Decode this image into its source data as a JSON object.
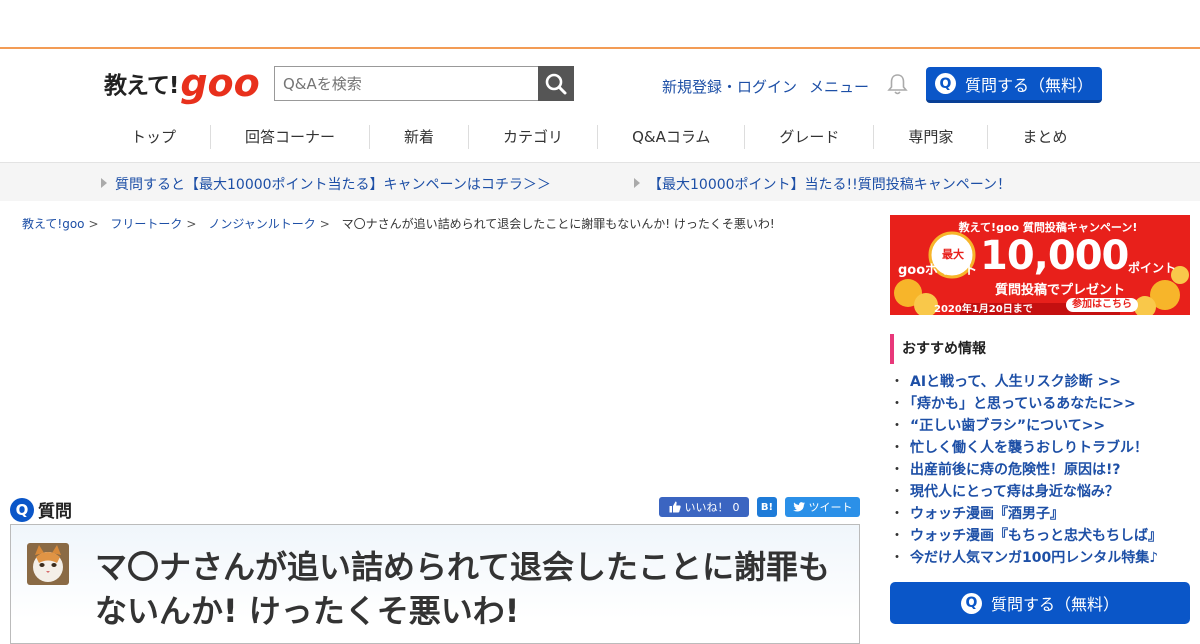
{
  "header": {
    "logo_jp": "教えて!",
    "logo_brand": "goo",
    "search_placeholder": "Q&Aを検索",
    "signup_login": "新規登録・ログイン",
    "menu": "メニュー",
    "ask_button": "質問する（無料）",
    "ask_q": "Q"
  },
  "nav": [
    "トップ",
    "回答コーナー",
    "新着",
    "カテゴリ",
    "Q&Aコラム",
    "グレード",
    "専門家",
    "まとめ"
  ],
  "campaign": {
    "link1": "質問すると【最大10000ポイント当たる】キャンペーンはコチラ＞＞",
    "link2": "【最大10000ポイント】当たる!!質問投稿キャンペーン！"
  },
  "breadcrumb": {
    "home": "教えて!goo",
    "cat1": "フリートーク",
    "cat2": "ノンジャンルトーク",
    "current": "マ〇ナさんが追い詰められて退会したことに謝罪もないんか! けったくそ悪いわ!",
    "sep": ">"
  },
  "question": {
    "badge": "Q",
    "label": "質問",
    "like_label": "いいね！",
    "like_count": "0",
    "hatena": "B!",
    "tweet": "ツイート",
    "title": "マ〇ナさんが追い詰められて退会したことに謝罪もないんか! けったくそ悪いわ!"
  },
  "banner": {
    "top": "教えて!goo 質問投稿キャンペーン!",
    "goo_point": "gooポイント",
    "max": "最大",
    "amount": "10,000",
    "unit": "ポイント",
    "sub": "質問投稿でプレゼント",
    "deadline": "2020年1月20日まで",
    "cta": "参加はこちら"
  },
  "recommend": {
    "heading": "おすすめ情報",
    "items": [
      "AIと戦って、人生リスク診断 >>",
      "「痔かも」と思っているあなたに>>",
      "“正しい歯ブラシ”について>>",
      "忙しく働く人を襲うおしりトラブル！",
      "出産前後に痔の危険性！原因は!?",
      "現代人にとって痔は身近な悩み？",
      "ウォッチ漫画『酒男子』",
      "ウォッチ漫画『もちっと忠犬もちしば』",
      "今だけ人気マンガ100円レンタル特集♪"
    ],
    "dot": "・"
  },
  "side_ask": "質問する（無料）",
  "colors": {
    "brand_red": "#e8301c",
    "link_blue": "#1d4fa6",
    "button_blue": "#0a56c8",
    "top_border": "#f39c55"
  }
}
